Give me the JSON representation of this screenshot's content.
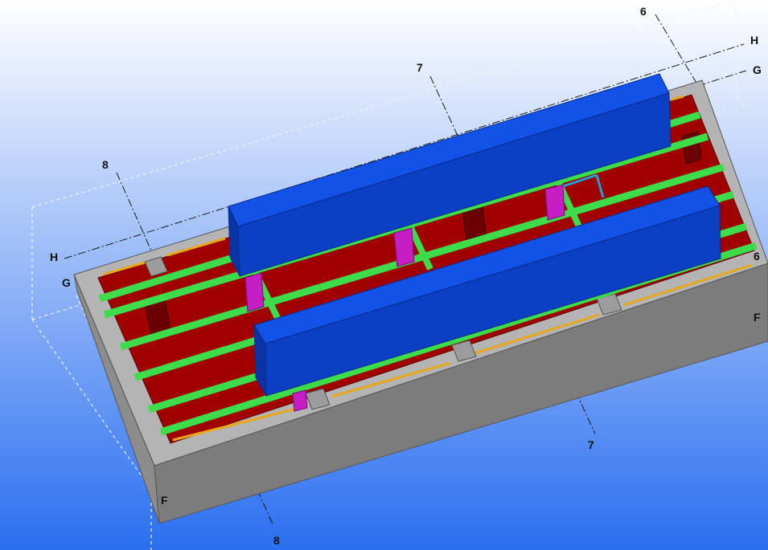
{
  "viewport": {
    "background_top": "#ffffff",
    "background_bottom": "#2a6ff0"
  },
  "grid_labels": {
    "g6_top": "6",
    "h_right": "H",
    "g_right": "G",
    "g7_top": "7",
    "g8_left": "8",
    "h_left": "H",
    "g_left": "G",
    "g6_right": "6",
    "f_right": "F",
    "g7_bottom": "7",
    "f_left": "F",
    "g8_bottom": "8"
  },
  "colors": {
    "concrete_top": "#b4b4b4",
    "concrete_side": "#8c8c8c",
    "concrete_front": "#7c7c7c",
    "plate": "#a00000",
    "stiffener": "#3ddc4a",
    "tank_front": "#0b3fc4",
    "tank_top": "#1252e6",
    "tank_end": "#0a34a6",
    "support": "#c41ec4",
    "trim": "#e8a81a",
    "accent": "#20a0d8"
  }
}
